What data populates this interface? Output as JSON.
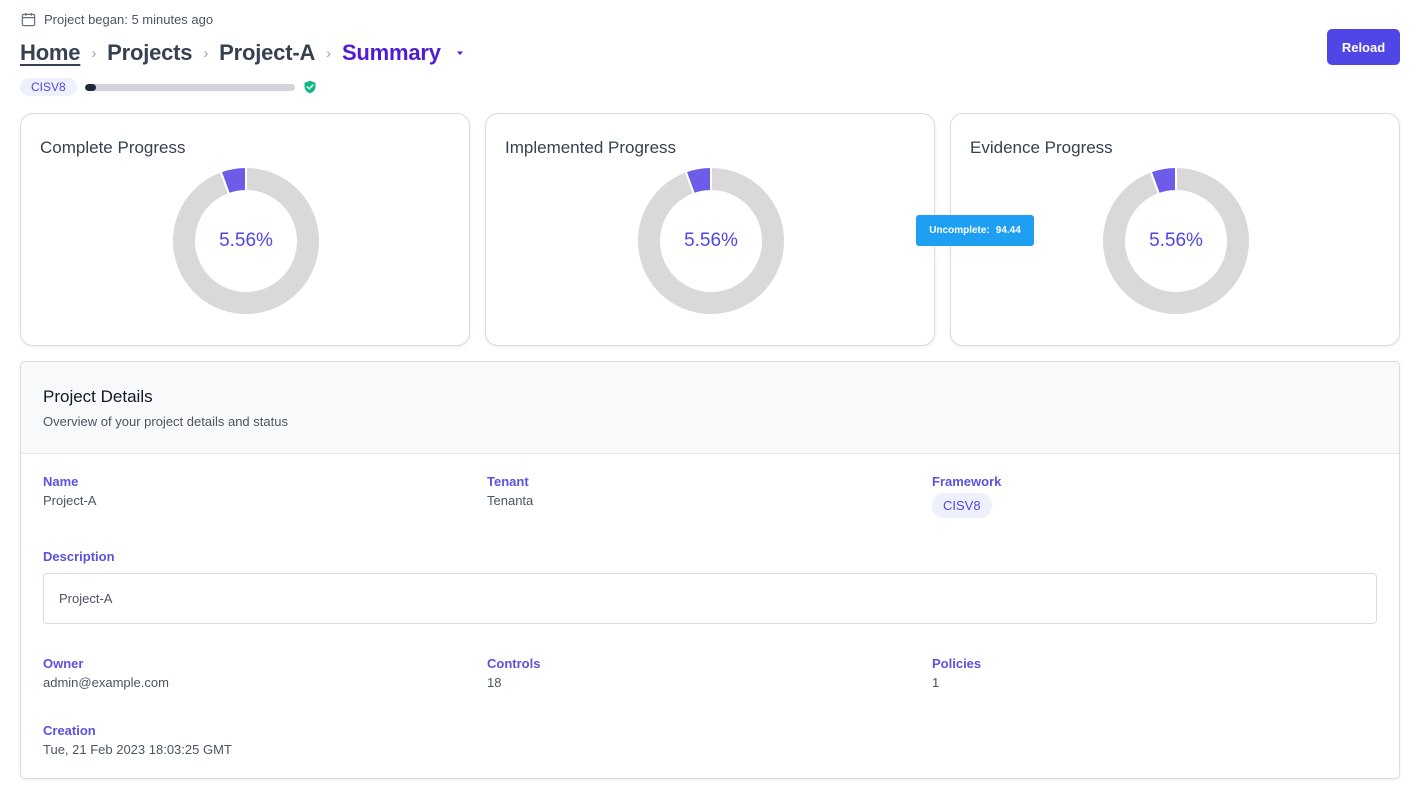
{
  "meta": {
    "project_began": "Project began: 5 minutes ago"
  },
  "breadcrumb": {
    "home": "Home",
    "projects": "Projects",
    "project": "Project-A",
    "current": "Summary",
    "separator": "›"
  },
  "reload_label": "Reload",
  "framework_tag": "CISV8",
  "overall_progress_fraction": 0.0556,
  "colors": {
    "accent": "#4f46e5",
    "active_crumb": "#4f1bd6",
    "donut_filled": "#6c5ce7",
    "donut_empty": "#d9d9d9",
    "tooltip": "#1e9ff2",
    "shield": "#10b981"
  },
  "cards": [
    {
      "title": "Complete Progress",
      "percent_label": "5.56%"
    },
    {
      "title": "Implemented Progress",
      "percent_label": "5.56%"
    },
    {
      "title": "Evidence Progress",
      "percent_label": "5.56%"
    }
  ],
  "chart_data": [
    {
      "type": "pie",
      "title": "Complete Progress",
      "categories": [
        "Complete",
        "Uncomplete"
      ],
      "values": [
        5.56,
        94.44
      ]
    },
    {
      "type": "pie",
      "title": "Implemented Progress",
      "categories": [
        "Implemented",
        "Uncomplete"
      ],
      "values": [
        5.56,
        94.44
      ]
    },
    {
      "type": "pie",
      "title": "Evidence Progress",
      "categories": [
        "Evidence",
        "Uncomplete"
      ],
      "values": [
        5.56,
        94.44
      ]
    }
  ],
  "tooltip": {
    "label": "Uncomplete:",
    "value": "94.44"
  },
  "details": {
    "title": "Project Details",
    "subtitle": "Overview of your project details and status",
    "name_label": "Name",
    "name": "Project-A",
    "tenant_label": "Tenant",
    "tenant": "Tenanta",
    "framework_label": "Framework",
    "framework": "CISV8",
    "description_label": "Description",
    "description": "Project-A",
    "owner_label": "Owner",
    "owner": "admin@example.com",
    "controls_label": "Controls",
    "controls": "18",
    "policies_label": "Policies",
    "policies": "1",
    "creation_label": "Creation",
    "creation": "Tue, 21 Feb 2023 18:03:25 GMT"
  }
}
